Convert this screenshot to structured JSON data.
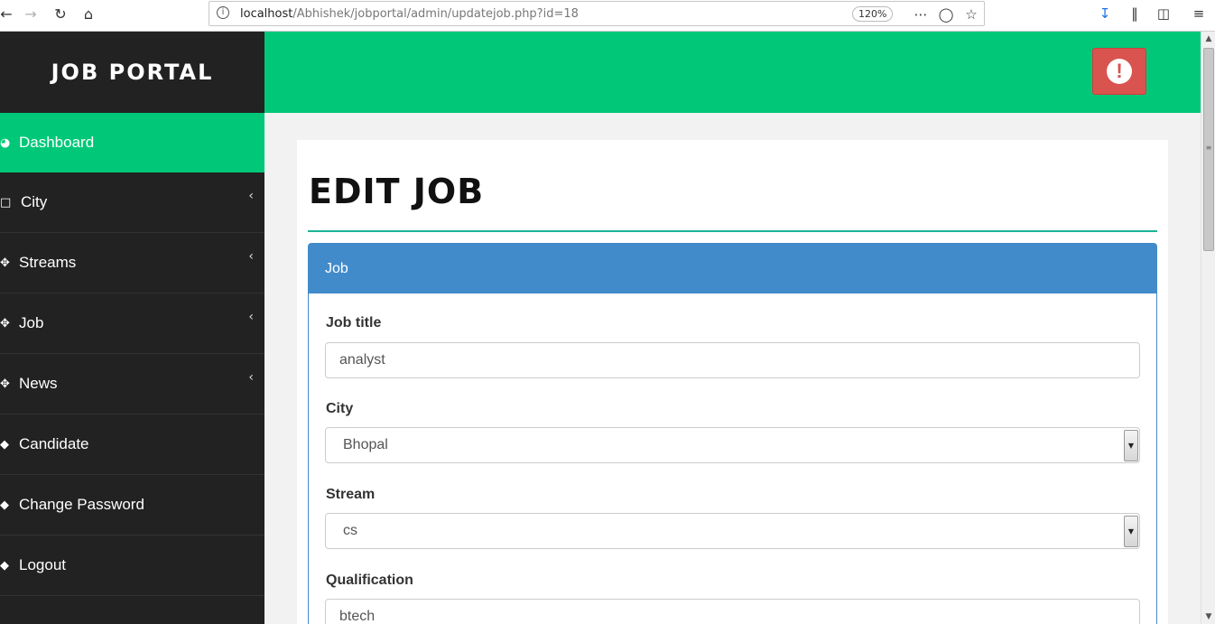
{
  "browser": {
    "back_icon": "back-arrow-icon",
    "forward_icon": "forward-arrow-icon",
    "url_host": "localhost",
    "url_path": "/Abhishek/jobportal/admin/updatejob.php?id=18",
    "zoom": "120%"
  },
  "sidebar": {
    "brand": "JOB PORTAL",
    "items": [
      {
        "label": "Dashboard",
        "icon": "dashboard-icon",
        "active": true,
        "has_submenu": false
      },
      {
        "label": "City",
        "icon": "desktop-icon",
        "active": false,
        "has_submenu": true
      },
      {
        "label": "Streams",
        "icon": "sitemap-icon",
        "active": false,
        "has_submenu": true
      },
      {
        "label": "Job",
        "icon": "sitemap-icon",
        "active": false,
        "has_submenu": true
      },
      {
        "label": "News",
        "icon": "sitemap-icon",
        "active": false,
        "has_submenu": true
      },
      {
        "label": "Candidate",
        "icon": "diamond-icon",
        "active": false,
        "has_submenu": false
      },
      {
        "label": "Change Password",
        "icon": "diamond-icon",
        "active": false,
        "has_submenu": false
      },
      {
        "label": "Logout",
        "icon": "diamond-icon",
        "active": false,
        "has_submenu": false
      }
    ]
  },
  "header": {
    "alert_icon": "exclamation-circle-icon",
    "alert_glyph": "!"
  },
  "main": {
    "title": "EDIT JOB",
    "panel_heading": "Job",
    "fields": {
      "job_title": {
        "label": "Job title",
        "value": "analyst"
      },
      "city": {
        "label": "City",
        "selected": "Bhopal"
      },
      "stream": {
        "label": "Stream",
        "selected": "cs"
      },
      "qualification": {
        "label": "Qualification",
        "value": "btech"
      }
    }
  },
  "colors": {
    "accent_green": "#00c878",
    "sidebar_dark": "#222222",
    "panel_blue": "#428bca",
    "alert_red": "#d9534f",
    "title_rule": "#1ab394"
  }
}
